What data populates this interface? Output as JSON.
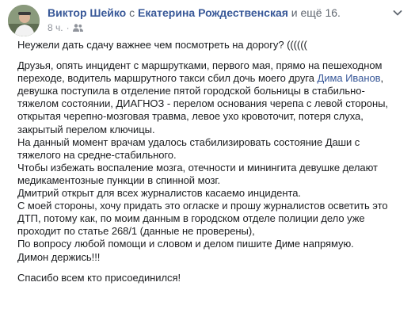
{
  "header": {
    "author": "Виктор Шейко",
    "with_word": " с ",
    "tagged_person": "Екатерина Рождественская",
    "and_others": " и ещё 16.",
    "time": "8 ч.",
    "dot": "·",
    "audience_icon": "friends-icon",
    "menu_icon": "chevron-down-icon"
  },
  "post": {
    "line1": "Неужели дать сдачу важнее чем посмотреть на дорогу? ((((((",
    "para_a_before": "Друзья, опять инцидент с маршрутками, первого мая, прямо на пешеходном переходе, водитель маршрутного такси сбил дочь моего друга ",
    "mention": "Дима Иванов",
    "para_a_after": ", девушка поступила в отделение пятой городской больницы в стабильно-тяжелом состоянии, ДИАГНОЗ - перелом основания черепа с левой стороны, открытая черепно-мозговая травма, левое ухо кровоточит, потеря слуха, закрытый перелом ключицы.",
    "para_b": "На данный момент врачам удалось стабилизировать состояние Даши с тяжелого на средне-стабильного.",
    "para_c": "Чтобы избежать воспаление мозга, отечности и мининги­та девушке делают медикаментозные пункции в спинной мозг.",
    "para_d": "Дмитрий открыт для всех журналистов касаемо инцидента.",
    "para_e": "С моей стороны, хочу придать это огласке и прошу журналистов осветить это ДТП, потому как, по моим данным в городском отделе полиции дело уже проходит по статье 268/1 (данные не проверены),",
    "para_f": "По вопросу любой помощи и словом и делом пишите Диме напрямую.",
    "para_g": "Димон держись!!!",
    "para_h": "Спасибо всем кто присоединился!"
  }
}
